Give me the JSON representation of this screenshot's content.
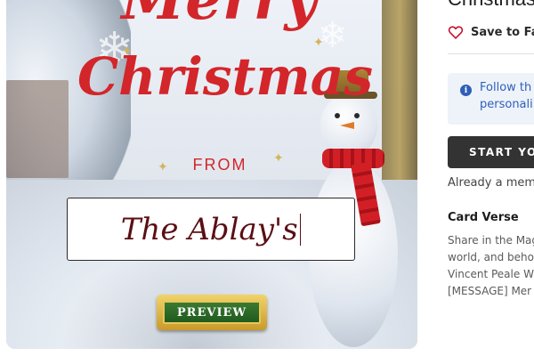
{
  "card": {
    "greeting_line1": "Merry",
    "greeting_line2": "Christmas",
    "greeting_line3": "FROM",
    "name_value": "The Ablay's",
    "preview_label": "PREVIEW"
  },
  "panel": {
    "title": "Christmas",
    "favorite_label": "Save to Favo",
    "info_line1": "Follow th",
    "info_line2": "personali",
    "start_button": "START YOU",
    "member_text": "Already a mem",
    "verse_heading": "Card Verse",
    "verse_lines": [
      "Share in the Mag",
      "world, and behol",
      "Vincent Peale W",
      "[MESSAGE] Mer"
    ]
  },
  "colors": {
    "accent_red": "#d3262a",
    "info_blue": "#2f5fb8",
    "button_dark": "#333333",
    "name_ink": "#5a0f14"
  },
  "icons": {
    "favorite": "heart-outline-icon",
    "info": "info-circle-icon"
  }
}
